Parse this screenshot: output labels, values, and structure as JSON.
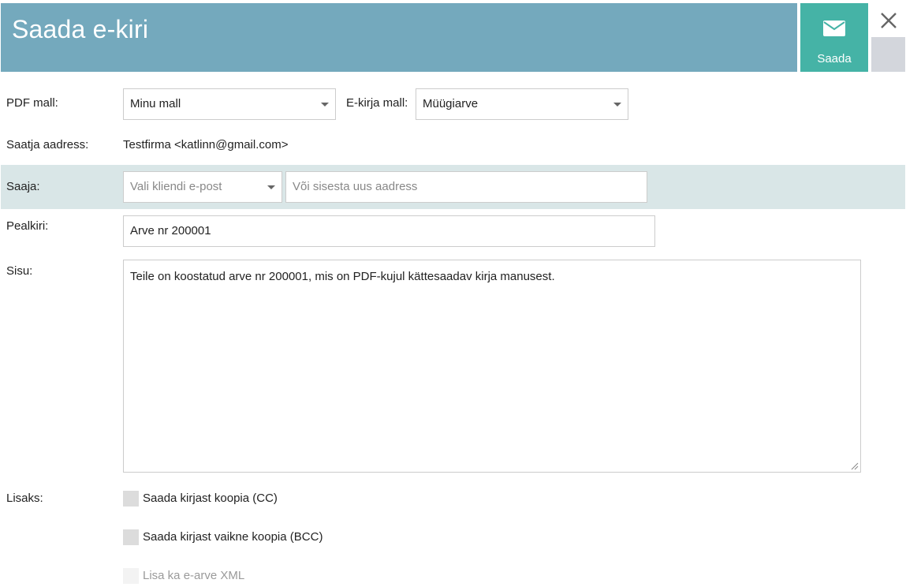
{
  "header": {
    "title": "Saada e-kiri",
    "send_label": "Saada",
    "close_glyph": "×",
    "send_icon": "envelope-icon"
  },
  "form": {
    "pdf_template_label": "PDF mall:",
    "pdf_template_value": "Minu mall",
    "email_template_label": "E-kirja mall:",
    "email_template_value": "Müügiarve",
    "sender_label": "Saatja aadress:",
    "sender_value": "Testfirma <katlinn@gmail.com>",
    "recipient_label": "Saaja:",
    "recipient_select_placeholder": "Vali kliendi e-post",
    "recipient_input_placeholder": "Või sisesta uus aadress",
    "subject_label": "Pealkiri:",
    "subject_value": "Arve nr 200001",
    "body_label": "Sisu:",
    "body_value": "Teile on koostatud arve nr 200001, mis on PDF-kujul kättesaadav kirja manusest.",
    "extras_label": "Lisaks:",
    "options": [
      {
        "label": "Saada kirjast koopia (CC)",
        "checked": false,
        "disabled": false
      },
      {
        "label": "Saada kirjast vaikne koopia (BCC)",
        "checked": false,
        "disabled": false
      },
      {
        "label": "Lisa ka e-arve XML",
        "checked": false,
        "disabled": true
      }
    ]
  },
  "colors": {
    "header_bg": "#74a9bd",
    "send_bg": "#45b3a6",
    "recipient_row_bg": "#d9e6e7"
  }
}
